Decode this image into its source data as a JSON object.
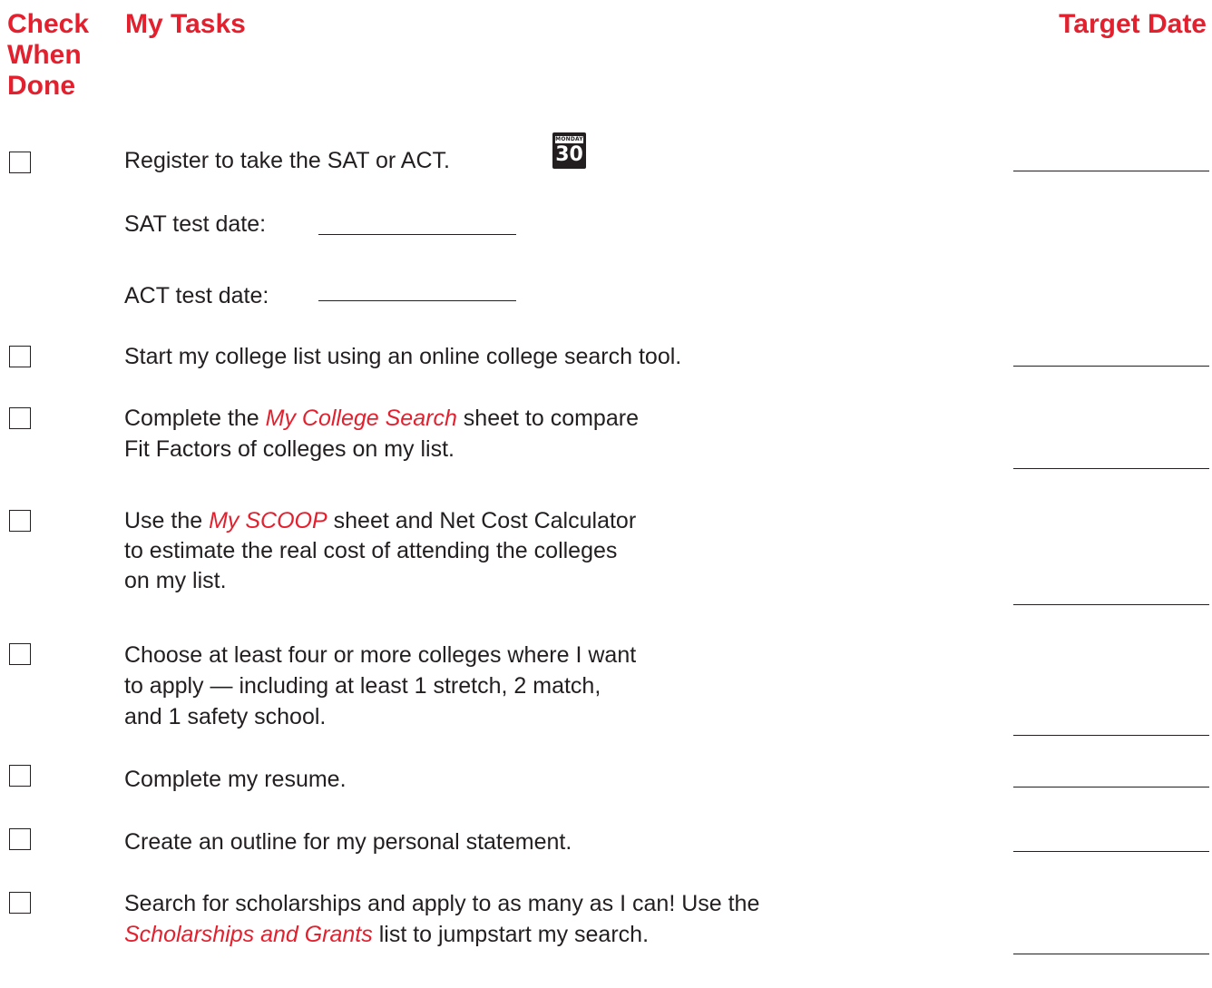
{
  "header": {
    "check_line1": "Check",
    "check_line2": "When",
    "check_line3": "Done",
    "tasks": "My Tasks",
    "target": "Target Date"
  },
  "calendar_icon": {
    "day_name": "MONDAY",
    "day_number": "30"
  },
  "tasks": [
    {
      "text": "Register to take the SAT or ACT."
    },
    {
      "text": "Start my college list using an online college search tool."
    },
    {
      "pre": "Complete the ",
      "italic": "My College Search",
      "post": " sheet to compare",
      "line2": "Fit Factors of colleges on my list."
    },
    {
      "pre": "Use the ",
      "italic": "My SCOOP",
      "post": " sheet and  Net Cost Calculator",
      "line2": "to estimate the real cost of attending the colleges",
      "line3": "on my list."
    },
    {
      "line1": "Choose at least four or more colleges where I want",
      "line2": "to apply — including at least 1 stretch, 2 match,",
      "line3": "and 1 safety school."
    },
    {
      "text": "Complete my resume."
    },
    {
      "text": "Create an outline for my personal statement."
    },
    {
      "line1": "Search for scholarships and apply to as many as I can! Use the",
      "italic": "Scholarships and Grants",
      "post": " list to jumpstart my search."
    }
  ],
  "sat_label": "SAT test date:",
  "act_label": "ACT test date:",
  "colors": {
    "accent": "#e3202e",
    "text": "#231f20"
  }
}
